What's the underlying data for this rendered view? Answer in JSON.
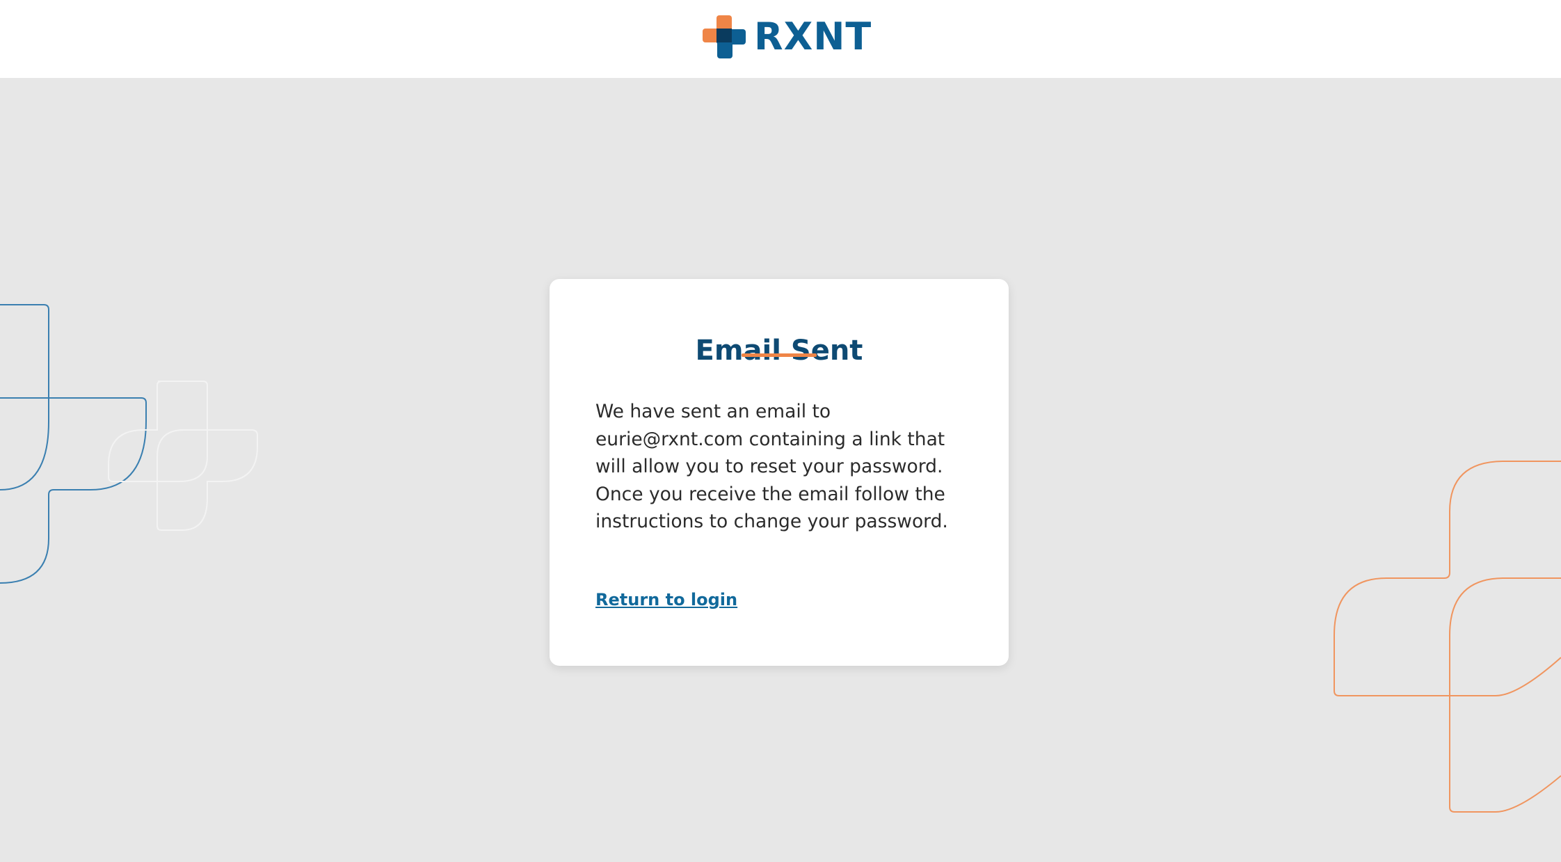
{
  "header": {
    "brand_name": "RXNT",
    "logo_icon": "rxnt-cross-logo-icon"
  },
  "card": {
    "title": "Email Sent",
    "message": "We have sent an email to eurie@rxnt.com containing a link that will allow you to reset your password. Once you receive the email follow the instructions to change your password.",
    "return_link_label": "Return to login"
  },
  "decorations": {
    "left": "blue-cross-outline-decoration",
    "right": "orange-cross-outline-decoration"
  },
  "colors": {
    "page_background": "#e7e7e7",
    "brand_blue": "#0d5f93",
    "title_color": "#0e4a73",
    "accent_orange": "#ef8547",
    "link_blue": "#11699b",
    "text": "#2b2b2b"
  }
}
